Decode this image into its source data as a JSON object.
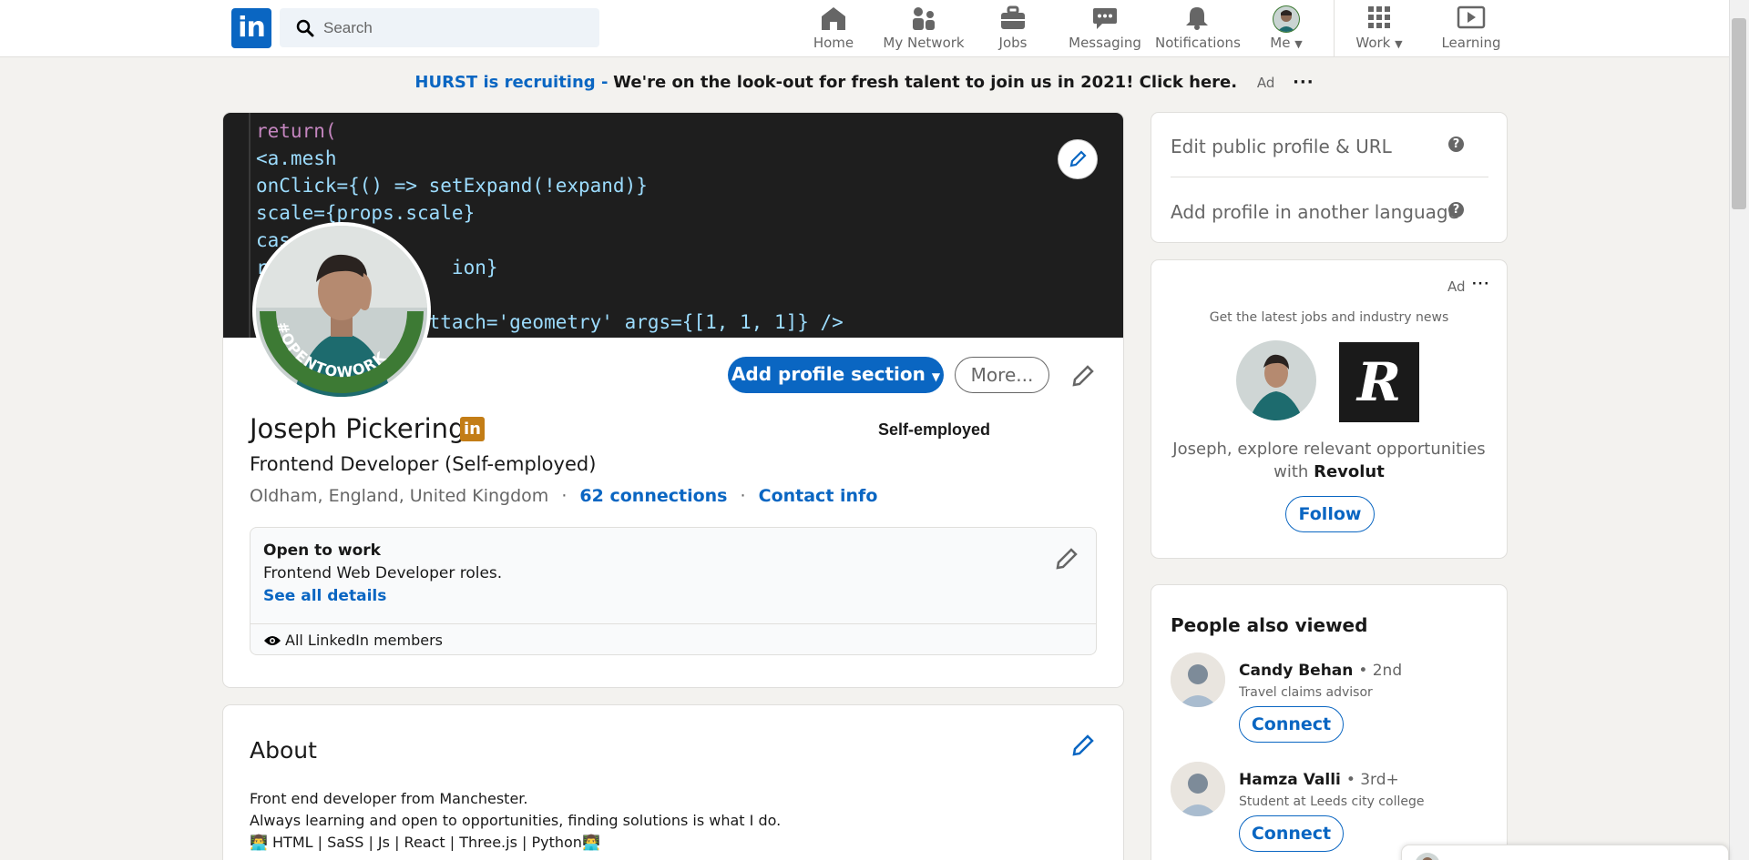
{
  "nav": {
    "logo_text": "in",
    "search_placeholder": "Search",
    "items": [
      {
        "label": "Home",
        "icon": "home-icon"
      },
      {
        "label": "My Network",
        "icon": "network-icon"
      },
      {
        "label": "Jobs",
        "icon": "briefcase-icon"
      },
      {
        "label": "Messaging",
        "icon": "messaging-icon"
      },
      {
        "label": "Notifications",
        "icon": "bell-icon"
      },
      {
        "label": "Me",
        "icon": "avatar"
      },
      {
        "label": "Work",
        "icon": "grid-icon"
      },
      {
        "label": "Learning",
        "icon": "play-icon"
      }
    ]
  },
  "ad_banner": {
    "company": "HURST is recruiting -",
    "message": "We're on the look-out for fresh talent to join us in 2021! Click here.",
    "ad_label": "Ad",
    "more": "···"
  },
  "cover": {
    "code_lines": [
      "return(",
      "<a.mesh",
      "onClick={() => setExpand(!expand)}",
      "scale={props.scale}",
      "cas",
      "r                ion}",
      "",
      "         etry attach='geometry' args={[1, 1, 1]} />"
    ]
  },
  "profile": {
    "badge_text": "#OPENTOWORK",
    "name": "Joseph Pickering",
    "in_badge": "in",
    "headline": "Frontend Developer (Self-employed)",
    "location": "Oldham, England, United Kingdom",
    "separator": "·",
    "connections": "62 connections",
    "contact": "Contact info",
    "current_company": "Self-employed",
    "add_section_label": "Add profile section",
    "more_label": "More..."
  },
  "open_to_work": {
    "title": "Open to work",
    "roles": "Frontend Web Developer roles.",
    "see_all": "See all details",
    "visibility": "All LinkedIn members"
  },
  "about": {
    "title": "About",
    "lines": [
      "Front end developer from Manchester.",
      "Always learning and open to opportunities, finding solutions is what I do.",
      "👨‍💻 HTML | SaSS | Js | React | Three.js | Python👨‍💻"
    ]
  },
  "sidebar": {
    "edit_public_profile": "Edit public profile & URL",
    "add_language": "Add profile in another language",
    "help_glyph": "?"
  },
  "ad_card": {
    "ad_label": "Ad",
    "more": "···",
    "tagline": "Get the latest jobs and industry news",
    "revolut_logo": "R",
    "line1": "Joseph, explore relevant opportunities",
    "line2_prefix": "with ",
    "line2_company": "Revolut",
    "follow_label": "Follow"
  },
  "people_also_viewed": {
    "title": "People also viewed",
    "people": [
      {
        "name": "Candy Behan",
        "degree": "• 2nd",
        "role": "Travel claims advisor",
        "action": "Connect"
      },
      {
        "name": "Hamza Valli",
        "degree": "• 3rd+",
        "role": "Student at Leeds city college",
        "action": "Connect"
      }
    ]
  },
  "colors": {
    "brand_blue": "#0a66c2",
    "page_bg": "#f3f2ef",
    "otw_green": "#3d7a34",
    "in_badge": "#c37d16"
  }
}
